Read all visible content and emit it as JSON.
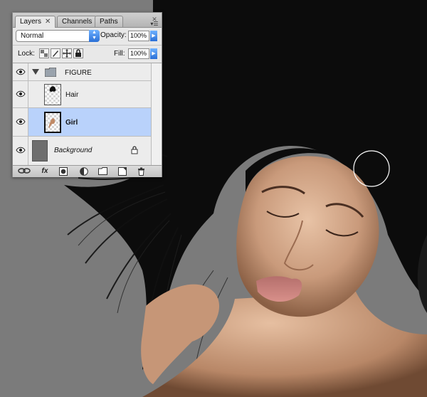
{
  "panel": {
    "tabs": [
      {
        "label": "Layers"
      },
      {
        "label": "Channels"
      },
      {
        "label": "Paths"
      }
    ],
    "tab_close_glyph": "✕",
    "close_glyph": "✕",
    "menu_glyph": "▾☰",
    "blend_mode": "Normal",
    "opacity_label": "Opacity:",
    "opacity_value": "100%",
    "lock_label": "Lock:",
    "fill_label": "Fill:",
    "fill_value": "100%",
    "layers": [
      {
        "name": "FIGURE",
        "type": "group",
        "expanded": true
      },
      {
        "name": "Hair",
        "type": "layer"
      },
      {
        "name": "Girl",
        "type": "layer",
        "selected": true
      },
      {
        "name": "Background",
        "type": "background",
        "locked": true
      }
    ],
    "bottom_buttons": [
      {
        "icon": "link-icon"
      },
      {
        "icon": "fx-icon",
        "label": "fx"
      },
      {
        "icon": "mask-icon"
      },
      {
        "icon": "adjustment-icon"
      },
      {
        "icon": "new-group-icon"
      },
      {
        "icon": "new-layer-icon"
      },
      {
        "icon": "trash-icon"
      }
    ]
  },
  "colors": {
    "selection": "#b9d2fb",
    "accent": "#2a6fd6",
    "canvas_bg": "#7b7b7b"
  },
  "canvas": {
    "content": "photo of woman with flowing dark hair, eyes closed",
    "brush_cursor": "circle"
  }
}
